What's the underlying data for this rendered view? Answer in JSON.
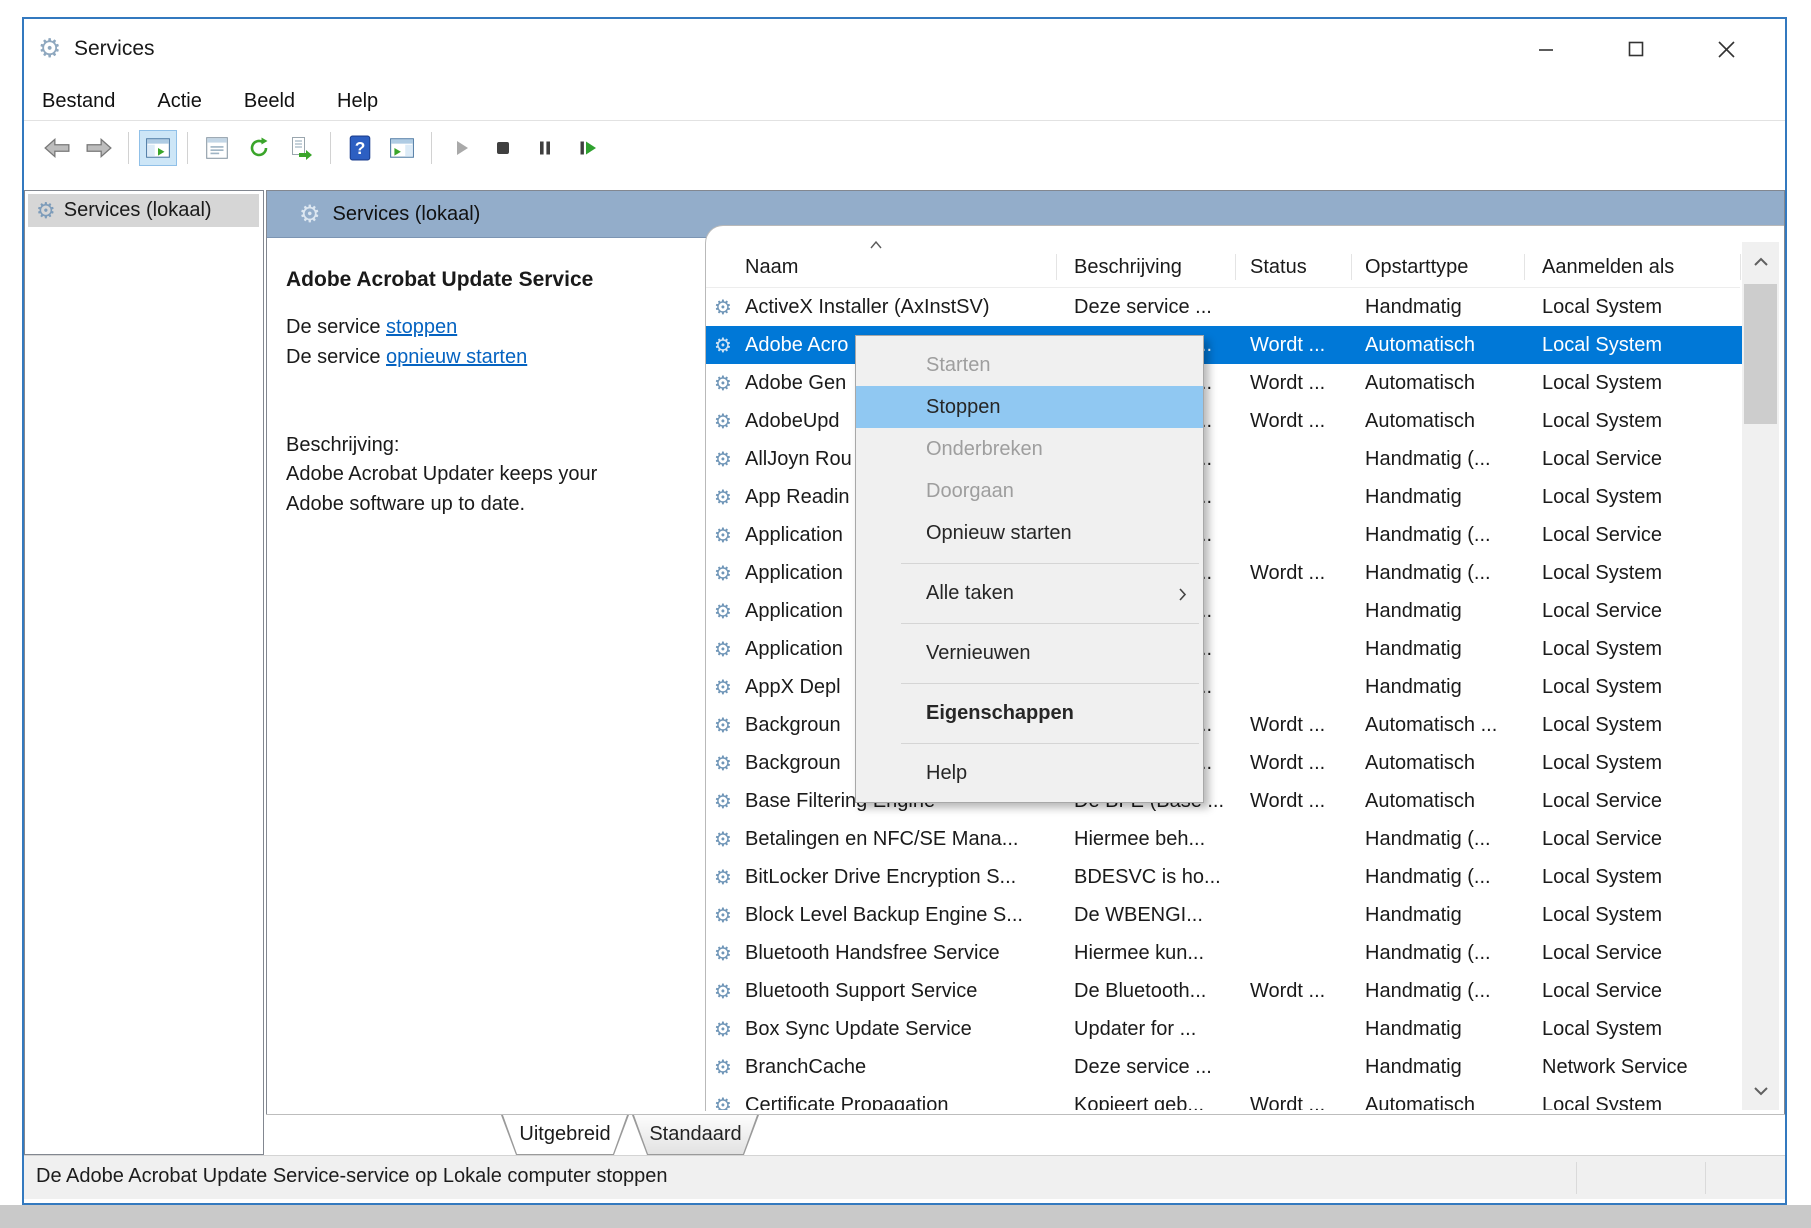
{
  "window": {
    "title": "Services"
  },
  "titlebar": {
    "buttons": [
      "minimize",
      "maximize",
      "close"
    ]
  },
  "menubar": {
    "items": [
      "Bestand",
      "Actie",
      "Beeld",
      "Help"
    ]
  },
  "toolbar": {
    "icons": [
      "back",
      "forward",
      "sep",
      "show-console-tree",
      "sep",
      "properties",
      "refresh",
      "export-list",
      "sep",
      "help",
      "show-action-pane",
      "sep",
      "start-service",
      "stop-service",
      "pause-service",
      "restart-service"
    ],
    "active_icon": "show-console-tree"
  },
  "tree": {
    "root_label": "Services (lokaal)"
  },
  "content_header": {
    "label": "Services (lokaal)"
  },
  "detail_pane": {
    "service_name": "Adobe Acrobat Update Service",
    "stop_prefix": "De service ",
    "stop_link": "stoppen",
    "restart_prefix": "De service ",
    "restart_link": "opnieuw starten",
    "description_label": "Beschrijving:",
    "description_line1": "Adobe Acrobat Updater keeps your",
    "description_line2": "Adobe software up to date."
  },
  "list": {
    "columns": [
      "Naam",
      "Beschrijving",
      "Status",
      "Opstarttype",
      "Aanmelden als"
    ],
    "sorted_column": "Naam",
    "rows": [
      {
        "name": "ActiveX Installer (AxInstSV)",
        "description": "Deze service ...",
        "status": "",
        "startup": "Handmatig",
        "logon": "Local System",
        "selected": false,
        "covered": false
      },
      {
        "name": "Adobe Acro",
        "description": "...",
        "status": "Wordt ...",
        "startup": "Automatisch",
        "logon": "Local System",
        "selected": true,
        "covered": true
      },
      {
        "name": "Adobe Gen",
        "description": "...",
        "status": "Wordt ...",
        "startup": "Automatisch",
        "logon": "Local System",
        "selected": false,
        "covered": true
      },
      {
        "name": "AdobeUpd",
        "description": "...",
        "status": "Wordt ...",
        "startup": "Automatisch",
        "logon": "Local System",
        "selected": false,
        "covered": true
      },
      {
        "name": "AllJoyn Rou",
        "description": "...",
        "status": "",
        "startup": "Handmatig (...",
        "logon": "Local Service",
        "selected": false,
        "covered": true
      },
      {
        "name": "App Readin",
        "description": "...",
        "status": "",
        "startup": "Handmatig",
        "logon": "Local System",
        "selected": false,
        "covered": true
      },
      {
        "name": "Application",
        "description": "...",
        "status": "",
        "startup": "Handmatig (...",
        "logon": "Local Service",
        "selected": false,
        "covered": true
      },
      {
        "name": "Application",
        "description": "...",
        "status": "Wordt ...",
        "startup": "Handmatig (...",
        "logon": "Local System",
        "selected": false,
        "covered": true
      },
      {
        "name": "Application",
        "description": "...",
        "status": "",
        "startup": "Handmatig",
        "logon": "Local Service",
        "selected": false,
        "covered": true
      },
      {
        "name": "Application",
        "description": "...",
        "status": "",
        "startup": "Handmatig",
        "logon": "Local System",
        "selected": false,
        "covered": true
      },
      {
        "name": "AppX Depl",
        "description": "...",
        "status": "",
        "startup": "Handmatig",
        "logon": "Local System",
        "selected": false,
        "covered": true
      },
      {
        "name": "Backgroun",
        "description": "...",
        "status": "Wordt ...",
        "startup": "Automatisch ...",
        "logon": "Local System",
        "selected": false,
        "covered": true
      },
      {
        "name": "Backgroun",
        "description": "...",
        "status": "Wordt ...",
        "startup": "Automatisch",
        "logon": "Local System",
        "selected": false,
        "covered": true
      },
      {
        "name": "Base Filtering Engine",
        "description": "De BFE (Base ...",
        "status": "Wordt ...",
        "startup": "Automatisch",
        "logon": "Local Service",
        "selected": false,
        "covered": false
      },
      {
        "name": "Betalingen en NFC/SE Mana...",
        "description": "Hiermee beh...",
        "status": "",
        "startup": "Handmatig (...",
        "logon": "Local Service",
        "selected": false,
        "covered": false
      },
      {
        "name": "BitLocker Drive Encryption S...",
        "description": "BDESVC is ho...",
        "status": "",
        "startup": "Handmatig (...",
        "logon": "Local System",
        "selected": false,
        "covered": false
      },
      {
        "name": "Block Level Backup Engine S...",
        "description": "De WBENGI...",
        "status": "",
        "startup": "Handmatig",
        "logon": "Local System",
        "selected": false,
        "covered": false
      },
      {
        "name": "Bluetooth Handsfree Service",
        "description": "Hiermee kun...",
        "status": "",
        "startup": "Handmatig (...",
        "logon": "Local Service",
        "selected": false,
        "covered": false
      },
      {
        "name": "Bluetooth Support Service",
        "description": "De Bluetooth...",
        "status": "Wordt ...",
        "startup": "Handmatig (...",
        "logon": "Local Service",
        "selected": false,
        "covered": false
      },
      {
        "name": "Box Sync Update Service",
        "description": "Updater for ...",
        "status": "",
        "startup": "Handmatig",
        "logon": "Local System",
        "selected": false,
        "covered": false
      },
      {
        "name": "BranchCache",
        "description": "Deze service ...",
        "status": "",
        "startup": "Handmatig",
        "logon": "Network Service",
        "selected": false,
        "covered": false
      },
      {
        "name": "Certificate Propagation",
        "description": "Kopieert geb...",
        "status": "Wordt ...",
        "startup": "Automatisch",
        "logon": "Local System",
        "selected": false,
        "covered": false
      }
    ]
  },
  "context_menu": {
    "items": [
      {
        "label": "Starten",
        "state": "disabled"
      },
      {
        "label": "Stoppen",
        "state": "hover"
      },
      {
        "label": "Onderbreken",
        "state": "disabled"
      },
      {
        "label": "Doorgaan",
        "state": "disabled"
      },
      {
        "label": "Opnieuw starten",
        "state": "normal"
      },
      {
        "type": "separator"
      },
      {
        "label": "Alle taken",
        "state": "normal",
        "submenu": true
      },
      {
        "type": "separator"
      },
      {
        "label": "Vernieuwen",
        "state": "normal"
      },
      {
        "type": "separator"
      },
      {
        "label": "Eigenschappen",
        "state": "normal",
        "bold": true
      },
      {
        "type": "separator"
      },
      {
        "label": "Help",
        "state": "normal"
      }
    ]
  },
  "tabs": [
    {
      "label": "Uitgebreid",
      "active": true
    },
    {
      "label": "Standaard",
      "active": false
    }
  ],
  "status_bar": {
    "text": "De Adobe Acrobat Update Service-service op Lokale computer stoppen"
  },
  "colors": {
    "selection": "#0078d7",
    "menu_highlight": "#90c8f2",
    "header_band": "#93adca",
    "window_border": "#3379bf",
    "link": "#0563c1"
  }
}
